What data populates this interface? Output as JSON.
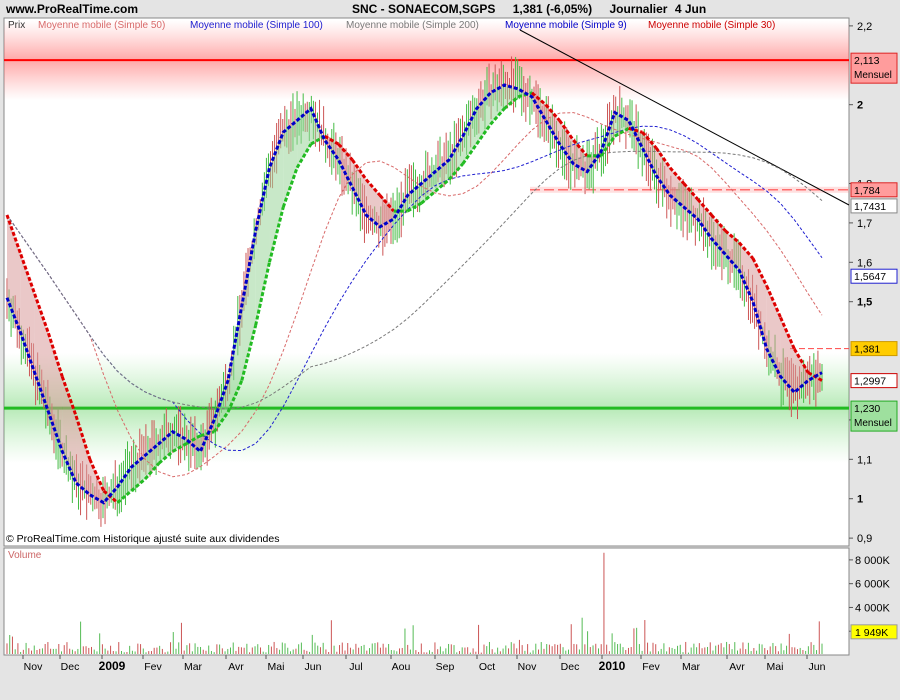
{
  "header": {
    "site": "www.ProRealTime.com",
    "instrument": "SNC - SONAECOM,SGPS",
    "last_change": "1,381 (-6,05%)",
    "period": "Journalier",
    "date": "4 Jun"
  },
  "chart_data": {
    "type": "line",
    "title": "SNC - SONAECOM,SGPS",
    "price_panel_label": "Prix",
    "volume_panel_label": "Volume",
    "copyright": "© ProRealTime.com Historique ajusté suite aux dividendes",
    "legend": [
      {
        "name": "Moyenne mobile (Simple 50)",
        "color": "#d86a6a"
      },
      {
        "name": "Moyenne mobile (Simple 100)",
        "color": "#2020d0"
      },
      {
        "name": "Moyenne mobile (Simple 200)",
        "color": "#7a7a7a"
      },
      {
        "name": "Moyenne mobile (Simple 9)",
        "color": "#0000c8"
      },
      {
        "name": "Moyenne mobile (Simple 30)",
        "color": "#cc0000"
      }
    ],
    "x_months": [
      "Nov",
      "Dec",
      "2009",
      "Fev",
      "Mar",
      "Avr",
      "Mai",
      "Jun",
      "Jul",
      "Aou",
      "Sep",
      "Oct",
      "Nov",
      "Dec",
      "2010",
      "Fev",
      "Mar",
      "Avr",
      "Mai",
      "Jun"
    ],
    "y_ticks": [
      "2,2",
      "2",
      "1,8",
      "1,7",
      "1,6",
      "1,5",
      "1,2",
      "1,1",
      "1",
      "0,9"
    ],
    "ylim": [
      0.88,
      2.22
    ],
    "volume_ticks": [
      "8 000K",
      "6 000K",
      "4 000K",
      "2 000K"
    ],
    "volume_ylim": [
      0,
      9000
    ],
    "levels": [
      {
        "value": 2.113,
        "label": "2,113",
        "tag": "Mensuel",
        "color": "#ff0000"
      },
      {
        "value": 1.23,
        "label": "1,230",
        "tag": "Mensuel",
        "color": "#22bb22"
      },
      {
        "value": 1.784,
        "label": "1,784",
        "color": "#ff4444"
      }
    ],
    "price_markers": [
      {
        "value": 1.7431,
        "label": "1,7431",
        "color": "#888888"
      },
      {
        "value": 1.5647,
        "label": "1,5647",
        "color": "#2020d0"
      },
      {
        "value": 1.381,
        "label": "1,381",
        "color": "#ffcc00"
      },
      {
        "value": 1.2997,
        "label": "1,2997",
        "color": "#cc0000"
      }
    ],
    "volume_marker": {
      "value": 1949,
      "label": "1 949K"
    },
    "series": [
      {
        "name": "Moyenne mobile (Simple 9)",
        "values": [
          1.51,
          1.42,
          1.32,
          1.22,
          1.12,
          1.04,
          1.01,
          0.99,
          1.03,
          1.08,
          1.11,
          1.14,
          1.17,
          1.15,
          1.12,
          1.2,
          1.3,
          1.49,
          1.68,
          1.84,
          1.93,
          1.96,
          1.99,
          1.91,
          1.86,
          1.79,
          1.72,
          1.69,
          1.71,
          1.77,
          1.8,
          1.83,
          1.86,
          1.92,
          1.99,
          2.03,
          2.05,
          2.04,
          2.02,
          1.96,
          1.9,
          1.85,
          1.83,
          1.88,
          1.98,
          1.96,
          1.89,
          1.82,
          1.77,
          1.74,
          1.71,
          1.66,
          1.62,
          1.58,
          1.5,
          1.38,
          1.31,
          1.27,
          1.3,
          1.32
        ]
      },
      {
        "name": "Moyenne mobile (Simple 30)",
        "values": [
          1.72,
          1.62,
          1.52,
          1.42,
          1.31,
          1.21,
          1.1,
          1.02,
          0.99,
          1.02,
          1.05,
          1.09,
          1.12,
          1.14,
          1.16,
          1.17,
          1.22,
          1.3,
          1.44,
          1.6,
          1.74,
          1.84,
          1.9,
          1.92,
          1.9,
          1.86,
          1.81,
          1.77,
          1.73,
          1.73,
          1.75,
          1.78,
          1.81,
          1.85,
          1.9,
          1.95,
          1.99,
          2.02,
          2.03,
          2.0,
          1.96,
          1.91,
          1.87,
          1.87,
          1.92,
          1.94,
          1.93,
          1.89,
          1.84,
          1.8,
          1.76,
          1.72,
          1.68,
          1.65,
          1.61,
          1.54,
          1.46,
          1.38,
          1.32,
          1.3
        ]
      }
    ]
  }
}
